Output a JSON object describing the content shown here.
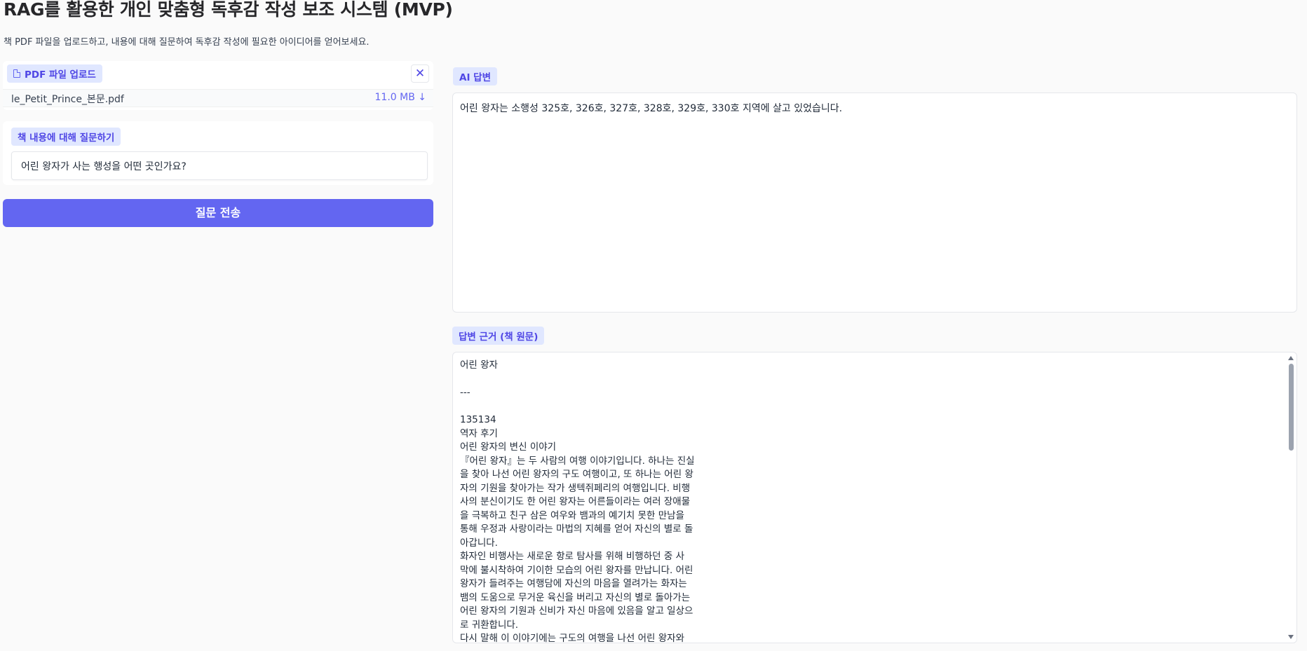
{
  "app": {
    "title": "RAG를 활용한 개인 맞춤형 독후감 작성 보조 시스템 (MVP)",
    "description": "책 PDF 파일을 업로드하고, 내용에 대해 질문하여 독후감 작성에 필요한 아이디어를 얻어보세요."
  },
  "upload": {
    "label": "PDF 파일 업로드",
    "label_icon": "file-icon",
    "close_icon": "close-icon",
    "close_glyph": "✕",
    "file_name": "le_Petit_Prince_본문.pdf",
    "file_size": "11.0 MB ↓"
  },
  "question": {
    "label": "책 내용에 대해 질문하기",
    "value": "어린 왕자가 사는 행성을 어떤 곳인가요?"
  },
  "submit": {
    "label": "질문 전송"
  },
  "answer": {
    "label": "AI 답변",
    "text": "어린 왕자는 소행성 325호, 326호, 327호, 328호, 329호, 330호 지역에 살고 있었습니다."
  },
  "evidence": {
    "label": "답변 근거 (책 원문)",
    "text": "어린 왕자\n\n---\n\n135134\n역자 후기\n어린 왕자의 변신 이야기\n『어린 왕자』는 두 사람의 여행 이야기입니다. 하나는 진실\n을 찾아 나선 어린 왕자의 구도 여행이고, 또 하나는 어린 왕\n자의 기원을 찾아가는 작가 생텍쥐페리의 여행입니다. 비행\n사의 분신이기도 한 어린 왕자는 어른들이라는 여러 장애물\n을 극복하고 친구 삼은 여우와 뱀과의 예기치 못한 만남을\n통해 우정과 사랑이라는 마법의 지혜를 얻어 자신의 별로 돌\n아갑니다.\n화자인 비행사는 새로운 항로 탐사를 위해 비행하던 중 사\n막에 불시착하여 기이한 모습의 어린 왕자를 만납니다. 어린\n왕자가 들려주는 여행담에 자신의 마음을 열려가는 화자는\n뱀의 도움으로 무거운 육신을 버리고 자신의 별로 돌아가는\n어린 왕자의 기원과 신비가 자신 마음에 있음을 알고 일상으\n로 귀환합니다.\n다시 말해 이 이야기에는 구도의 여행을 나선 어린 왕자와"
  }
}
